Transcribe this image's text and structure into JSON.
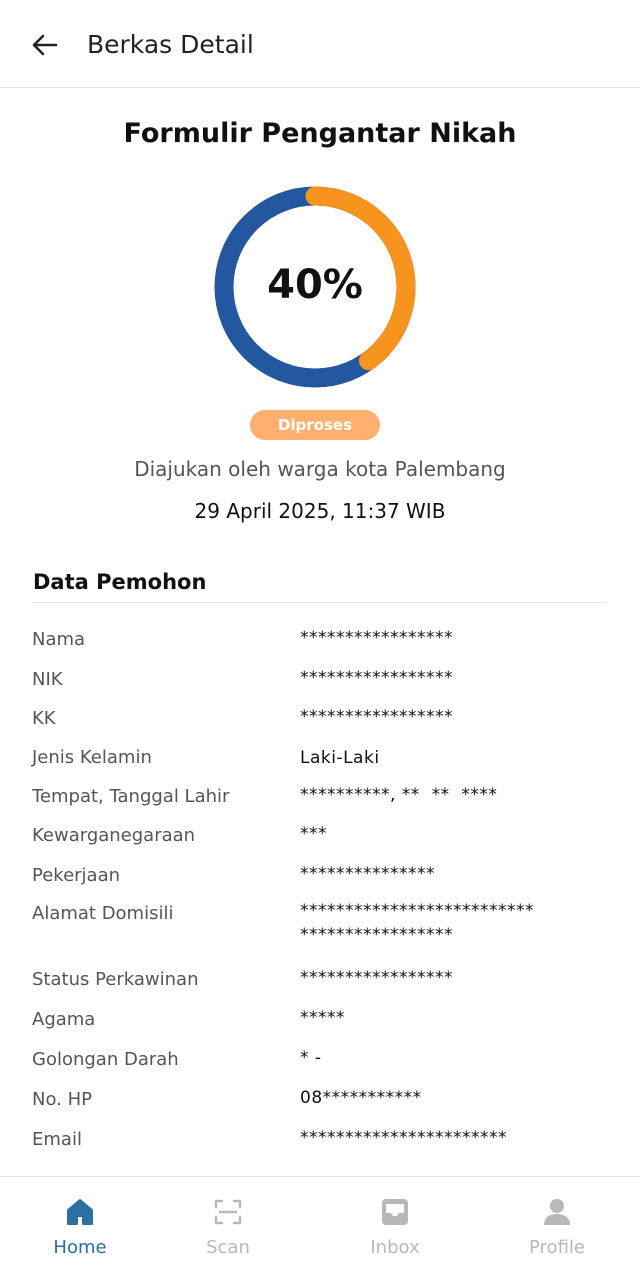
{
  "header": {
    "title": "Berkas Detail",
    "back_icon": "arrow-left-icon"
  },
  "summary": {
    "form_title": "Formulir Pengantar Nikah",
    "progress_percent": 40,
    "progress_label": "40%",
    "status": "Diproses",
    "submitted_by": "Diajukan oleh warga kota Palembang",
    "submitted_at": "29 April 2025, 11:37 WIB"
  },
  "colors": {
    "ring_primary": "#2358a0",
    "ring_progress": "#f7941d",
    "badge_bg": "#ffb070",
    "nav_active": "#2c6fa0",
    "nav_inactive": "#b8b8b8"
  },
  "data_pemohon": {
    "title": "Data Pemohon",
    "rows": [
      {
        "label": "Nama",
        "value": "*****************"
      },
      {
        "label": "NIK",
        "value": "*****************"
      },
      {
        "label": "KK",
        "value": "*****************"
      },
      {
        "label": "Jenis Kelamin",
        "value": "Laki-Laki"
      },
      {
        "label": "Tempat, Tanggal Lahir",
        "value": "**********, **  **  ****"
      },
      {
        "label": "Kewarganegaraan",
        "value": "***"
      },
      {
        "label": "Pekerjaan",
        "value": "***************"
      },
      {
        "label": "Alamat Domisili",
        "value": "**************************\n*****************"
      },
      {
        "label": "Status Perkawinan",
        "value": "*****************"
      },
      {
        "label": "Agama",
        "value": "*****"
      },
      {
        "label": "Golongan Darah",
        "value": "* -"
      },
      {
        "label": "No. HP",
        "value": "08***********"
      },
      {
        "label": "Email",
        "value": "***********************"
      }
    ]
  },
  "bottom_nav": {
    "items": [
      {
        "label": "Home",
        "icon": "home-icon",
        "active": true
      },
      {
        "label": "Scan",
        "icon": "scan-icon",
        "active": false
      },
      {
        "label": "Inbox",
        "icon": "inbox-icon",
        "active": false
      },
      {
        "label": "Profile",
        "icon": "profile-icon",
        "active": false
      }
    ]
  }
}
